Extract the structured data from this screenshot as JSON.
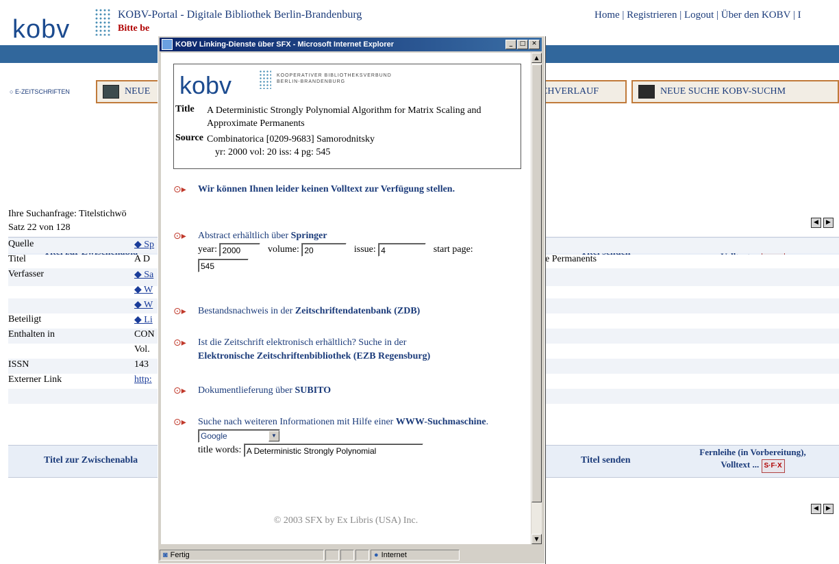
{
  "portal": {
    "logo": "kobv",
    "title": "KOBV-Portal - Digitale Bibliothek Berlin-Brandenburg",
    "warning": "Bitte be",
    "toplinks": "Home | Registrieren | Logout | Über den KOBV | I"
  },
  "nav": {
    "ezs": "E-ZEITSCHRIFTEN",
    "neue": "NEUE",
    "verlauf": "CHVERLAUF",
    "neue_suche": "NEUE SUCHE KOBV-SUCHM"
  },
  "results": {
    "query": "Ihre Suchanfrage: Titelstichwö",
    "satz": "Satz 22 von 128",
    "col_clipboard": "Titel zur Zwischenabla",
    "col_send": "Titel senden",
    "col_fernleihe_1": "Fernleihe (in Vorbereitung),",
    "col_fernleihe_2": "Volltext ...",
    "sfx_badge": "S·F·X",
    "rows": [
      {
        "label": "Quelle",
        "value": "◆ Sp"
      },
      {
        "label": "Titel",
        "value": "A D"
      },
      {
        "label": "Verfasser",
        "value": "◆ Sa"
      },
      {
        "label": "",
        "value": "◆ W"
      },
      {
        "label": "",
        "value": "◆ W"
      },
      {
        "label": "Beteiligt",
        "value": "◆ Li"
      },
      {
        "label": "Enthalten in",
        "value": "CON"
      },
      {
        "label": "",
        "value": "Vol."
      },
      {
        "label": "ISSN",
        "value": "143"
      },
      {
        "label": "Externer Link",
        "value": "http:"
      }
    ],
    "title_tail": "e Permanents"
  },
  "popup": {
    "window_title": "KOBV Linking-Dienste über SFX - Microsoft Internet Explorer",
    "logo": "kobv",
    "org_line1": "KOOPERATIVER BIBLIOTHEKSVERBUND",
    "org_line2": "BERLIN-BRANDENBURG",
    "title_label": "Title",
    "title_value": "A Deterministic Strongly Polynomial Algorithm for Matrix Scaling and Approximate Permanents",
    "source_label": "Source",
    "source_value": "Combinatorica [0209-9683] Samorodnitsky",
    "source_value2": "yr: 2000 vol: 20 iss: 4 pg: 545",
    "svc_fulltext": "Wir können Ihnen leider keinen Volltext zur Verfügung stellen.",
    "svc_abstract_pre": "Abstract erhältlich über ",
    "svc_abstract_link": "Springer",
    "year_label": "year:",
    "year_value": "2000",
    "volume_label": "volume:",
    "volume_value": "20",
    "issue_label": "issue:",
    "issue_value": "4",
    "startpage_label": "start page:",
    "startpage_value": "545",
    "svc_zdb_pre": "Bestandsnachweis in der ",
    "svc_zdb_link": "Zeitschriftendatenbank (ZDB)",
    "svc_ezb_pre": "Ist die Zeitschrift elektronisch erhältlich? Suche in der",
    "svc_ezb_link": "Elektronische Zeitschriftenbibliothek (EZB Regensburg)",
    "svc_subito_pre": "Dokumentlieferung über ",
    "svc_subito_link": "SUBITO",
    "svc_www_pre": "Suche nach weiteren Informationen mit Hilfe einer ",
    "svc_www_link": "WWW-Suchmaschine",
    "search_engine": "Google",
    "titlewords_label": "title words:",
    "titlewords_value": "A Deterministic Strongly Polynomial",
    "copyright": "© 2003 SFX by Ex Libris (USA) Inc.",
    "status_text": "Fertig",
    "status_zone": "Internet"
  }
}
